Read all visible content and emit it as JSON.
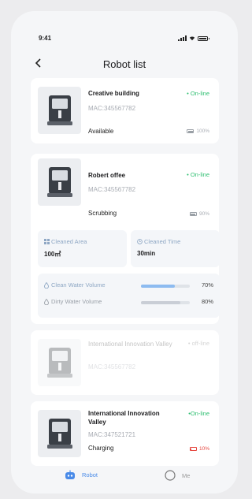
{
  "status_bar": {
    "time": "9:41"
  },
  "header": {
    "title": "Robot list"
  },
  "robots": [
    {
      "name": "Creative building",
      "mac": "MAC:345567782",
      "status": "• On-line",
      "state": "Available",
      "battery": "100%"
    },
    {
      "name": "Robert offee",
      "mac": "MAC:345567782",
      "status": "• On-line",
      "state": "Scrubbing",
      "battery": "90%",
      "stats": {
        "cleaned_area_label": "Cleaned Area",
        "cleaned_area_value": "100㎡",
        "cleaned_time_label": "Cleaned Time",
        "cleaned_time_value": "30min",
        "clean_water_label": "Clean Water Volume",
        "clean_water_pct": "70%",
        "dirty_water_label": "Dirty Water Volume",
        "dirty_water_pct": "80%"
      }
    },
    {
      "name": "International Innovation Valley",
      "mac": "MAC:345567782",
      "status": "• off-line"
    },
    {
      "name": "International Innovation Valley",
      "mac": "MAC:347521721",
      "status": "•On-line",
      "state": "Charging",
      "battery": "10%"
    }
  ],
  "tabbar": {
    "robot_label": "Robot",
    "me_label": "Me"
  },
  "colors": {
    "accent": "#4a8be8",
    "online": "#2fbf71",
    "low_battery": "#e5453d",
    "clean_water": "#8dbbf0",
    "dirty_water": "#c9ced6"
  },
  "levels": {
    "clean_water": 0.7,
    "dirty_water": 0.8,
    "battery_1": 1.0,
    "battery_2": 0.9,
    "battery_4": 0.1
  }
}
